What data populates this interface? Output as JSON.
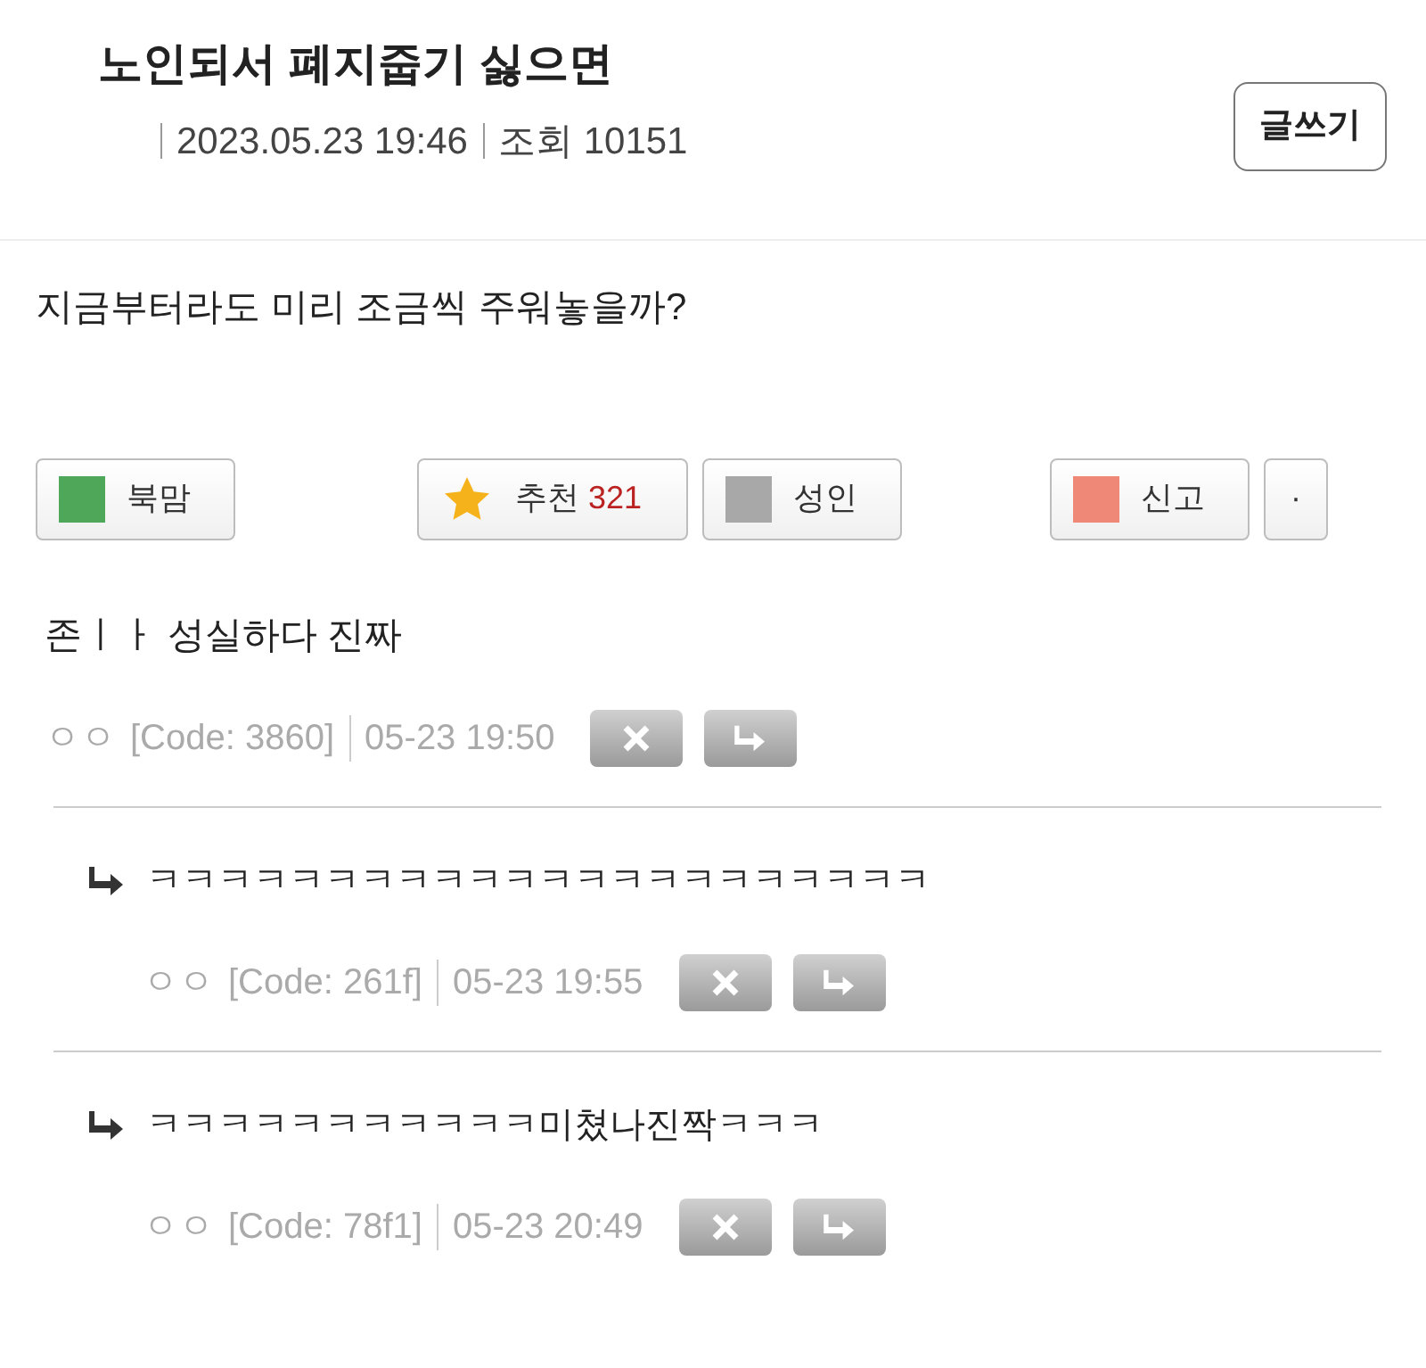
{
  "post": {
    "title": "노인되서 폐지줍기 싫으면",
    "date": "2023.05.23 19:46",
    "views_label": "조회",
    "views": "10151",
    "write_button": "글쓰기",
    "body": "지금부터라도 미리 조금씩 주워놓을까?"
  },
  "actions": [
    {
      "kind": "swatch",
      "label": "북맘",
      "color": "#4fa85a"
    },
    {
      "kind": "star",
      "label": "추천",
      "count": "321"
    },
    {
      "kind": "swatch",
      "label": "성인",
      "color": "#a8a8a8"
    },
    {
      "kind": "swatch",
      "label": "신고",
      "color": "#f08878"
    },
    {
      "kind": "more",
      "label": "·"
    }
  ],
  "comments": [
    {
      "text": "존ㅣㅏ 성실하다 진짜",
      "author": "ㅇㅇ",
      "code": "[Code: 3860]",
      "time": "05-23 19:50",
      "replies": [
        {
          "text": "ㅋㅋㅋㅋㅋㅋㅋㅋㅋㅋㅋㅋㅋㅋㅋㅋㅋㅋㅋㅋㅋㅋ",
          "author": "ㅇㅇ",
          "code": "[Code: 261f]",
          "time": "05-23 19:55"
        },
        {
          "text": "ㅋㅋㅋㅋㅋㅋㅋㅋㅋㅋㅋ미쳤나진짝ㅋㅋㅋ",
          "author": "ㅇㅇ",
          "code": "[Code: 78f1]",
          "time": "05-23 20:49"
        }
      ]
    }
  ]
}
